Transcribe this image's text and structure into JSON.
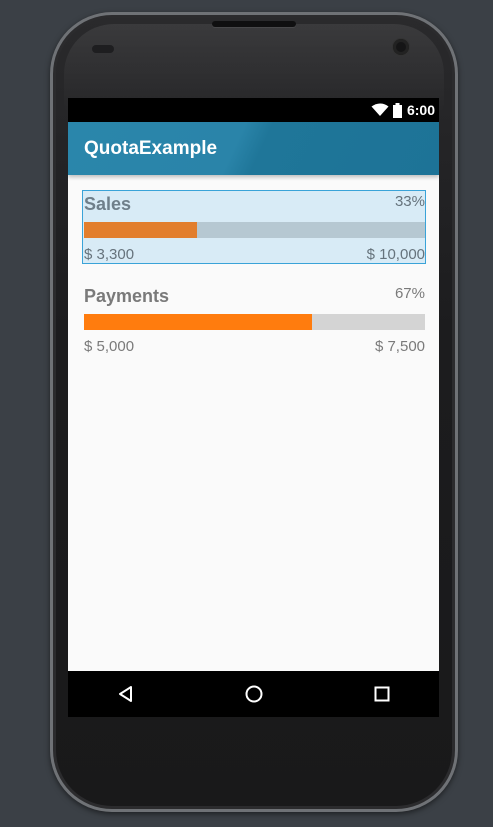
{
  "status_bar": {
    "time": "6:00",
    "icons": [
      "wifi-icon",
      "battery-icon"
    ]
  },
  "app_bar": {
    "title": "QuotaExample",
    "color": "#2a84a9"
  },
  "quotas": [
    {
      "label": "Sales",
      "percent_text": "33%",
      "progress": 0.33,
      "min_text": "$ 3,300",
      "max_text": "$ 10,000",
      "selected": true
    },
    {
      "label": "Payments",
      "percent_text": "67%",
      "progress": 0.67,
      "min_text": "$ 5,000",
      "max_text": "$ 7,500",
      "selected": false
    }
  ],
  "colors": {
    "progress_fill": "#ff7c0e",
    "progress_track": "#d4d4d4",
    "selection_highlight": "#d8ebf6"
  },
  "nav_bar": {
    "buttons": [
      "back-icon",
      "home-icon",
      "recents-icon"
    ]
  }
}
